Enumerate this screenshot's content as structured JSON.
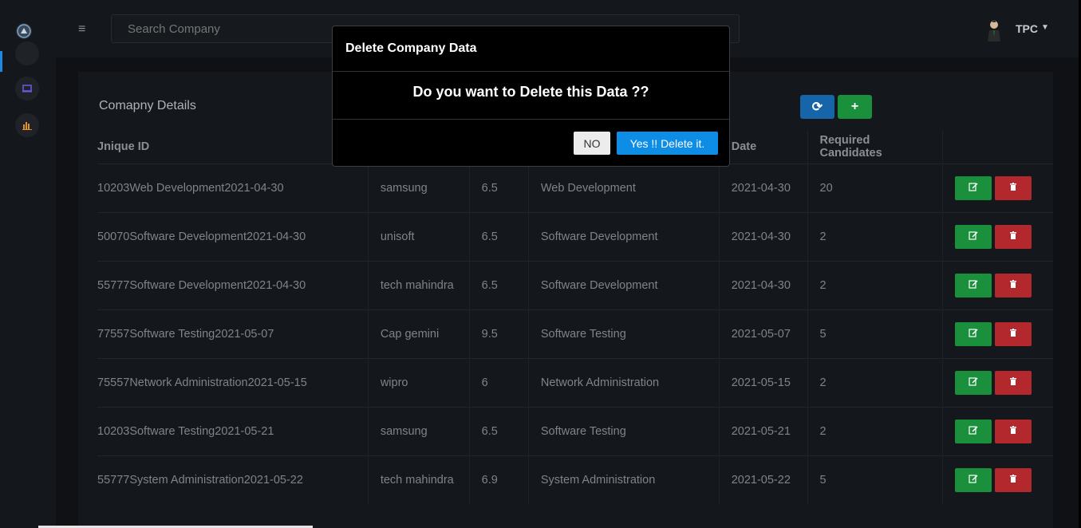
{
  "topbar": {
    "search_placeholder": "Search Company",
    "user_name": "TPC"
  },
  "card": {
    "title": "Comapny Details"
  },
  "table": {
    "headers": [
      "Jnique ID",
      "",
      "",
      "",
      "Date",
      "Required Candidates",
      ""
    ],
    "rows": [
      [
        "10203Web Development2021-04-30",
        "samsung",
        "6.5",
        "Web Development",
        "2021-04-30",
        "20"
      ],
      [
        "50070Software Development2021-04-30",
        "unisoft",
        "6.5",
        "Software Development",
        "2021-04-30",
        "2"
      ],
      [
        "55777Software Development2021-04-30",
        "tech mahindra",
        "6.5",
        "Software Development",
        "2021-04-30",
        "2"
      ],
      [
        "77557Software Testing2021-05-07",
        "Cap gemini",
        "9.5",
        "Software Testing",
        "2021-05-07",
        "5"
      ],
      [
        "75557Network Administration2021-05-15",
        "wipro",
        "6",
        "Network Administration",
        "2021-05-15",
        "2"
      ],
      [
        "10203Software Testing2021-05-21",
        "samsung",
        "6.5",
        "Software Testing",
        "2021-05-21",
        "2"
      ],
      [
        "55777System Administration2021-05-22",
        "tech mahindra",
        "6.9",
        "System Administration",
        "2021-05-22",
        "5"
      ]
    ]
  },
  "modal": {
    "title": "Delete Company Data",
    "message": "Do you want to Delete this Data ??",
    "no_label": "NO",
    "yes_label": "Yes !! Delete it."
  },
  "colors": {
    "accent": "#0d8de6",
    "edit": "#1a8f3c",
    "delete": "#b3282d",
    "refresh": "#1565a8"
  }
}
